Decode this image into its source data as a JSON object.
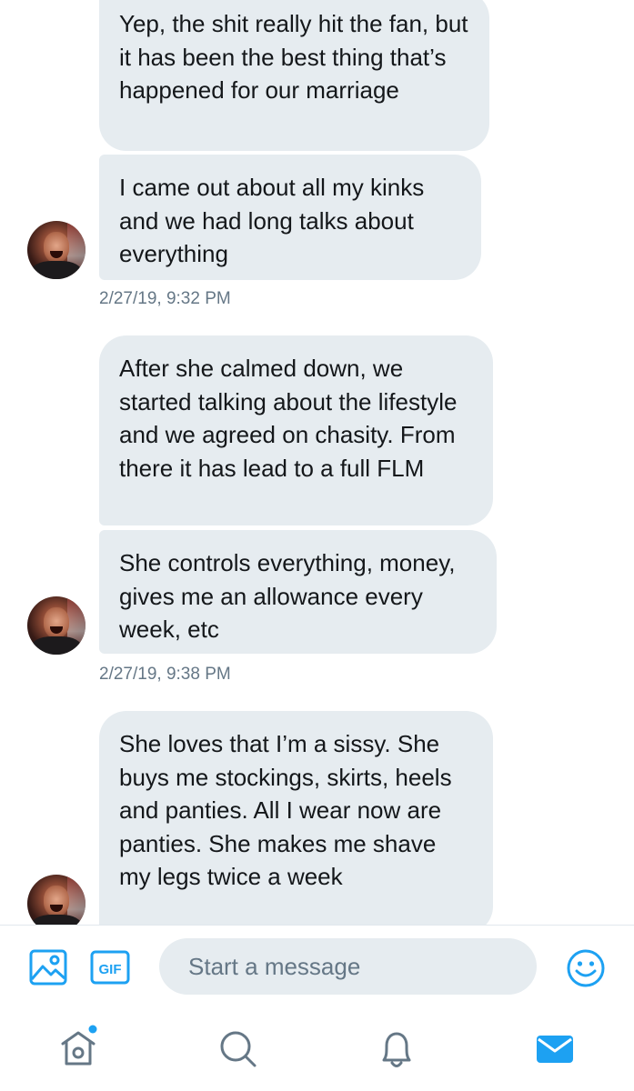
{
  "messages": [
    {
      "text": "Yep, the shit really hit the fan, but it has been the best thing that’s happened for our marriage"
    },
    {
      "text": "I came out about all my kinks and we had long talks about everything"
    },
    {
      "text": "After she calmed down, we started talking about the lifestyle and we agreed on chasity. From there it has lead to a full FLM"
    },
    {
      "text": "She controls everything, money, gives me an allowance every week, etc"
    },
    {
      "text": "She loves that I’m a sissy. She buys me stockings, skirts, heels and panties. All I wear now are panties. She makes me shave my legs twice a week"
    }
  ],
  "timestamps": [
    "2/27/19, 9:32 PM",
    "2/27/19, 9:38 PM"
  ],
  "composer": {
    "placeholder": "Start a message",
    "gif_label": "GIF",
    "icons": [
      "image-icon",
      "gif-icon",
      "emoji-icon"
    ]
  },
  "tabbar": {
    "icons": [
      "home-icon",
      "search-icon",
      "notifications-icon",
      "messages-icon"
    ],
    "active": "messages-icon",
    "home_has_new_indicator": true
  },
  "colors": {
    "accent": "#1da1f2",
    "bubble_bg": "#e6ecf0",
    "secondary_text": "#657786",
    "primary_text": "#14171a"
  }
}
